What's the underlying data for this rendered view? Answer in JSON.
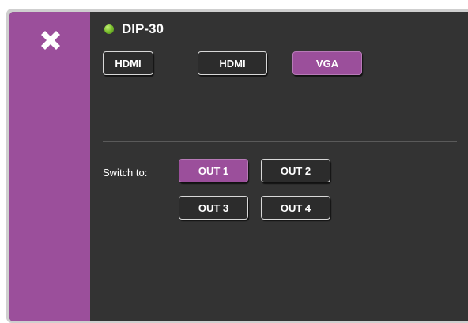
{
  "sidebar": {
    "close_icon": "close-x-icon",
    "color": "#9b4f9b"
  },
  "device": {
    "name": "DIP-30",
    "status_color": "#7fc231"
  },
  "inputs": [
    {
      "label": "HDMI",
      "active": false
    },
    {
      "label": "HDMI",
      "active": false
    },
    {
      "label": "VGA",
      "active": true
    }
  ],
  "switch": {
    "label": "Switch to:",
    "outputs": [
      {
        "label": "OUT 1",
        "active": true
      },
      {
        "label": "OUT 2",
        "active": false
      },
      {
        "label": "OUT 3",
        "active": false
      },
      {
        "label": "OUT 4",
        "active": false
      }
    ]
  },
  "colors": {
    "accent": "#9b4f9b",
    "panel_bg": "#333333"
  }
}
